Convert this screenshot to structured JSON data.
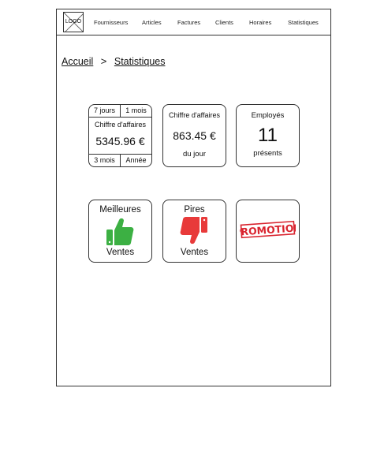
{
  "logo": {
    "label": "LOGO"
  },
  "nav": {
    "items": [
      "Fournisseurs",
      "Articles",
      "Factures",
      "Clients",
      "Horaires",
      "Statistiques"
    ]
  },
  "breadcrumb": {
    "home": "Accueil",
    "separator": ">",
    "current": "Statistiques"
  },
  "tiles": {
    "revenue_period": {
      "tabs_top": [
        "7 jours",
        "1 mois"
      ],
      "label": "Chiffre d'affaires",
      "value": "5345.96 €",
      "tabs_bottom": [
        "3 mois",
        "Année"
      ]
    },
    "revenue_day": {
      "label": "Chiffre d'affaires",
      "value": "863.45 €",
      "sub": "du jour"
    },
    "employees": {
      "label": "Employés",
      "value": "11",
      "sub": "présents"
    },
    "best_sales": {
      "top": "Meilleures",
      "bottom": "Ventes",
      "icon": "thumbs-up-icon",
      "color": "#3cb043"
    },
    "worst_sales": {
      "top": "Pires",
      "bottom": "Ventes",
      "icon": "thumbs-down-icon",
      "color": "#e83a3a"
    },
    "promotion": {
      "stamp": "PROMOTION",
      "color": "#d9232e"
    }
  }
}
